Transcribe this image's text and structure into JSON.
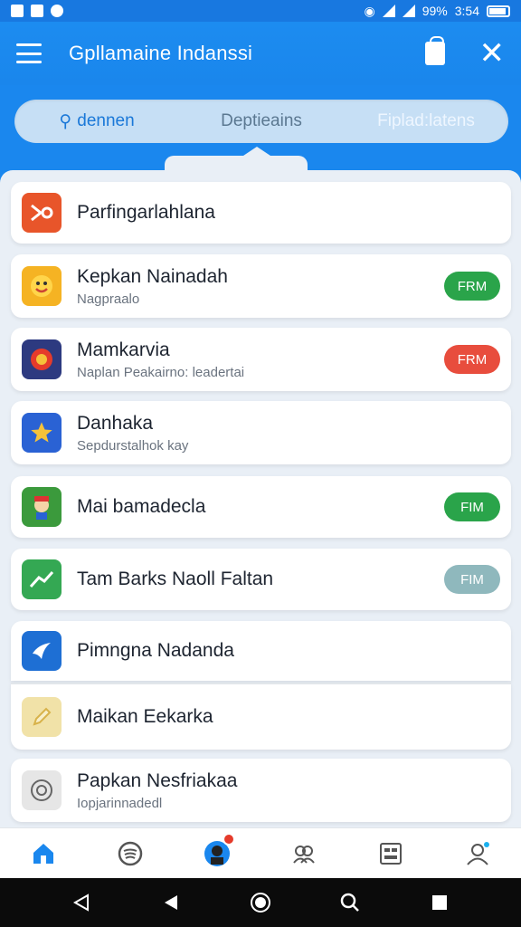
{
  "status_bar": {
    "battery_text": "99%",
    "time": "3:54"
  },
  "app_bar": {
    "title": "Gpllamaine Indanssi"
  },
  "tabs": [
    {
      "label": "dennen",
      "state": "active"
    },
    {
      "label": "Deptieains",
      "state": "normal"
    },
    {
      "label": "Fiplad:latens",
      "state": "light"
    }
  ],
  "list": [
    {
      "title": "Parfingarlahlana",
      "subtitle": "",
      "icon": "play-icon",
      "icon_color": "#e8552a",
      "pill": ""
    },
    {
      "title": "Kepkan Nainadah",
      "subtitle": "Nagpraalo",
      "icon": "emoji-icon",
      "icon_color": "#f5b323",
      "pill": "FRM",
      "pill_color": "#2aa44a"
    },
    {
      "title": "Mamkarvia",
      "subtitle": "Naplan Peakairno: leadertai",
      "icon": "badge-icon",
      "icon_color": "#2d3a80",
      "pill": "FRM",
      "pill_color": "#e84d3d"
    },
    {
      "title": "Danhaka",
      "subtitle": "Sepdurstalhok kay",
      "icon": "star-icon",
      "icon_color": "#2a62d4",
      "pill": ""
    },
    {
      "title": "Mai bamadecla",
      "subtitle": "",
      "icon": "character-icon",
      "icon_color": "#3b9a3c",
      "pill": "FIM",
      "pill_color": "#2aa44a"
    },
    {
      "title": "Tam Barks Naoll Faltan",
      "subtitle": "",
      "icon": "chart-icon",
      "icon_color": "#34a853",
      "pill": "FIM",
      "pill_color": "#8fb8bd"
    },
    {
      "title": "Pimngna Nadanda",
      "subtitle": "",
      "icon": "bird-icon",
      "icon_color": "#1e6fd4",
      "pill": ""
    },
    {
      "title": "Maikan Eekarka",
      "subtitle": "",
      "icon": "pencil-icon",
      "icon_color": "#f1e2a8",
      "pill": ""
    },
    {
      "title": "Papkan Nesfriakaa",
      "subtitle": "Iopjarinnadedl",
      "icon": "circle-icon",
      "icon_color": "#e6e6e6",
      "pill": ""
    }
  ],
  "colors": {
    "primary": "#1a87ee",
    "panel": "#e9eff6"
  }
}
